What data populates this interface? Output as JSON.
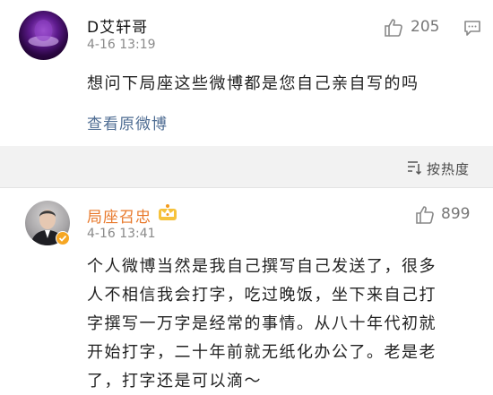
{
  "comments": [
    {
      "user": "D艾轩哥",
      "time": "4-16 13:19",
      "likes": "205",
      "text": "想问下局座这些微博都是您自己亲自写的吗",
      "link": "查看原微博"
    }
  ],
  "sort": {
    "label": "按热度",
    "icon": "sort-icon"
  },
  "reply": {
    "user": "局座召忠",
    "time": "4-16 13:41",
    "likes": "899",
    "badge_icon": "crown-badge-icon",
    "verified_icon": "verified-badge-icon",
    "text_lines": [
      "个人微博当然是我自己撰写自己发送了，很多",
      "人不相信我会打字，吃过晚饭，坐下来自己打",
      "字撰写一万字是经常的事情。从八十年代初就",
      "开始打字，二十年前就无纸化办公了。老是老",
      "了，打字还是可以滴～"
    ]
  },
  "colors": {
    "link": "#4f6d93",
    "official_name": "#e8782a",
    "background_band": "#f2f2f2"
  }
}
